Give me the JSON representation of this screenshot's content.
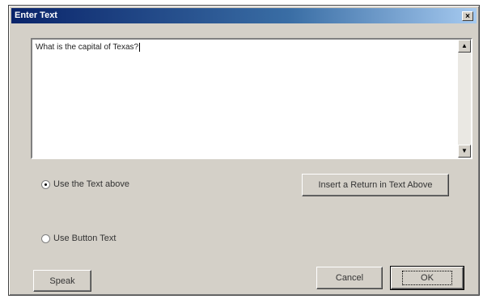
{
  "window": {
    "title": "Enter Text",
    "close_glyph": "×"
  },
  "editor": {
    "value": "What is the capital of Texas?"
  },
  "options": {
    "use_text_label": "Use the Text above",
    "use_text_selected": true,
    "use_button_label": "Use Button Text",
    "use_button_selected": false
  },
  "buttons": {
    "insert_return": "Insert a Return in Text Above",
    "speak": "Speak",
    "cancel": "Cancel",
    "ok": "OK"
  },
  "icons": {
    "scroll_up": "scroll-up-icon",
    "scroll_down": "scroll-down-icon"
  }
}
